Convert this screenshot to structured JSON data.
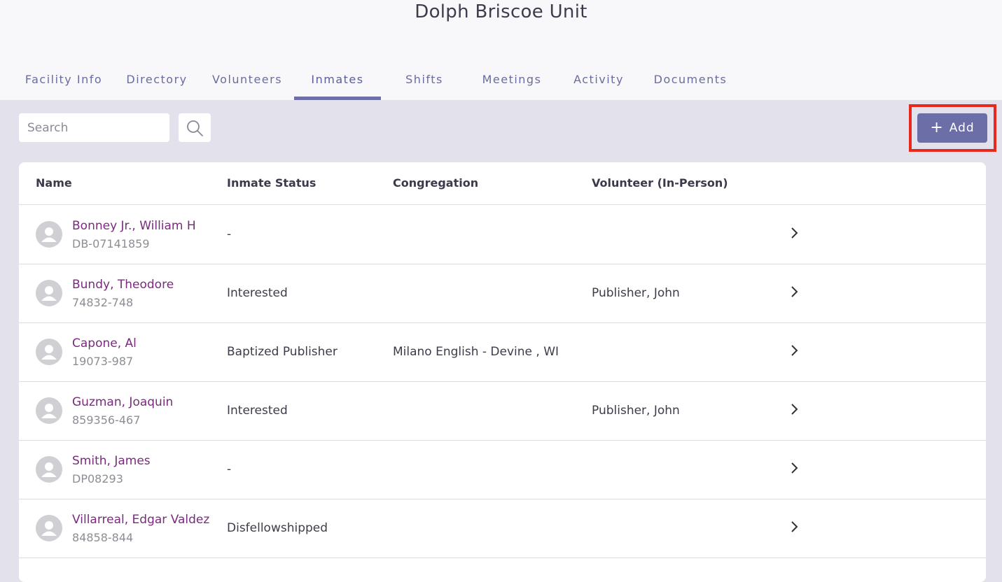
{
  "header": {
    "title": "Dolph Briscoe Unit",
    "tabs": [
      {
        "label": "Facility Info"
      },
      {
        "label": "Directory"
      },
      {
        "label": "Volunteers"
      },
      {
        "label": "Inmates",
        "active": true
      },
      {
        "label": "Shifts"
      },
      {
        "label": "Meetings"
      },
      {
        "label": "Activity"
      },
      {
        "label": "Documents"
      }
    ]
  },
  "toolbar": {
    "search_placeholder": "Search",
    "search_value": "",
    "add_label": "Add",
    "add_icon": "plus-icon",
    "search_icon": "magnifier-icon"
  },
  "table": {
    "columns": [
      "Name",
      "Inmate Status",
      "Congregation",
      "Volunteer (In-Person)"
    ],
    "rows": [
      {
        "name": "Bonney Jr., William H",
        "id": "DB-07141859",
        "status": "-",
        "congregation": "",
        "volunteer": ""
      },
      {
        "name": "Bundy, Theodore",
        "id": "74832-748",
        "status": "Interested",
        "congregation": "",
        "volunteer": "Publisher, John"
      },
      {
        "name": "Capone, Al",
        "id": "19073-987",
        "status": "Baptized Publisher",
        "congregation": "Milano English - Devine , WI",
        "volunteer": ""
      },
      {
        "name": "Guzman, Joaquin",
        "id": "859356-467",
        "status": "Interested",
        "congregation": "",
        "volunteer": "Publisher, John"
      },
      {
        "name": "Smith, James",
        "id": "DP08293",
        "status": "-",
        "congregation": "",
        "volunteer": ""
      },
      {
        "name": "Villarreal, Edgar Valdez",
        "id": "84858-844",
        "status": "Disfellowshipped",
        "congregation": "",
        "volunteer": ""
      }
    ]
  },
  "colors": {
    "accent": "#6c6ea8",
    "name_link": "#7a2a7e",
    "highlight": "#e8281c",
    "page_background": "#e3e2ec"
  }
}
